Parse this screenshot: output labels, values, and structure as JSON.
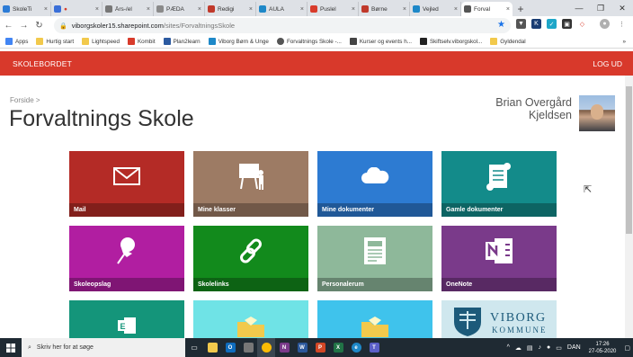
{
  "browser": {
    "tabs": [
      {
        "label": "SkoleTi",
        "color": "#2b7bd6"
      },
      {
        "label": "",
        "color": "#3a6fd8"
      },
      {
        "label": "Års-/el",
        "color": "#777777"
      },
      {
        "label": "PÆDA",
        "color": "#8a8a8a"
      },
      {
        "label": "Redigi",
        "color": "#c0392b"
      },
      {
        "label": "AULA",
        "color": "#1e88c8"
      },
      {
        "label": "Puslel",
        "color": "#d83b2b"
      },
      {
        "label": "Børne",
        "color": "#c0392b"
      },
      {
        "label": "Vejled",
        "color": "#1e88c8"
      },
      {
        "label": "Forval",
        "color": "#555555"
      }
    ],
    "new_tab": "+",
    "url_host": "viborgskoler15.sharepoint.com",
    "url_path": "/sites/ForvaltningsSkole",
    "bookmarks": [
      {
        "label": "Apps",
        "color": "#4285f4"
      },
      {
        "label": "Hurtig start",
        "color": "#f2c94c"
      },
      {
        "label": "Lightspeed",
        "color": "#f2c94c"
      },
      {
        "label": "Kombit",
        "color": "#d83b2b"
      },
      {
        "label": "Plan2learn",
        "color": "#2c5aa0"
      },
      {
        "label": "Viborg Børn & Unge",
        "color": "#1e88c8"
      },
      {
        "label": "Forvaltnings Skole -...",
        "color": "#555555"
      },
      {
        "label": "Kurser og events h...",
        "color": "#444444"
      },
      {
        "label": "Skiftselv.viborgskol...",
        "color": "#222222"
      },
      {
        "label": "Gyldendal",
        "color": "#f2c94c"
      }
    ],
    "more": "»"
  },
  "site": {
    "brand": "SKOLEBORDET",
    "logout": "LOG UD",
    "breadcrumb": "Forside >",
    "title": "Forvaltnings Skole",
    "user_first": "Brian Overgård",
    "user_last": "Kjeldsen",
    "tiles": [
      {
        "label": "Mail",
        "color": "#b42b26",
        "icon": "mail-icon"
      },
      {
        "label": "Mine klasser",
        "color": "#9d7b64",
        "icon": "presentation-icon"
      },
      {
        "label": "Mine dokumenter",
        "color": "#2d7bd2",
        "icon": "cloud-icon"
      },
      {
        "label": "Gamle dokumenter",
        "color": "#138b8a",
        "icon": "scroll-icon"
      },
      {
        "label": "Skoleopslag",
        "color": "#b11ea1",
        "icon": "pushpin-icon"
      },
      {
        "label": "Skolelinks",
        "color": "#128a1c",
        "icon": "link-icon"
      },
      {
        "label": "Personalerum",
        "color": "#8eb89a",
        "icon": "newspaper-icon"
      },
      {
        "label": "OneNote",
        "color": "#7a3a8a",
        "icon": "onenote-icon"
      },
      {
        "label": "",
        "color": "#14957a",
        "icon": "excel-icon"
      },
      {
        "label": "",
        "color": "#6fe3e6",
        "icon": "folder-icon"
      },
      {
        "label": "",
        "color": "#3fc3ec",
        "icon": "folder-icon"
      },
      {
        "label": "VIBORG",
        "sub": "KOMMUNE",
        "color": "#cfe7ee",
        "icon": "viborg-logo"
      }
    ]
  },
  "taskbar": {
    "search_placeholder": "Skriv her for at søge",
    "language": "DAN",
    "time": "17:26",
    "date": "27-05-2020"
  }
}
